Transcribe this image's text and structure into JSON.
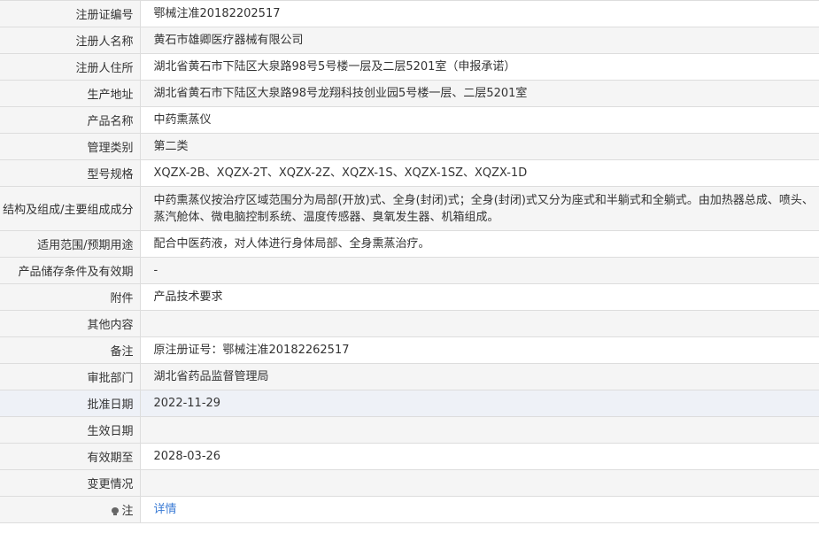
{
  "rows": [
    {
      "label": "注册证编号",
      "value": "鄂械注准20182202517"
    },
    {
      "label": "注册人名称",
      "value": "黄石市雄卿医疗器械有限公司"
    },
    {
      "label": "注册人住所",
      "value": "湖北省黄石市下陆区大泉路98号5号楼一层及二层5201室（申报承诺）"
    },
    {
      "label": "生产地址",
      "value": "湖北省黄石市下陆区大泉路98号龙翔科技创业园5号楼一层、二层5201室"
    },
    {
      "label": "产品名称",
      "value": "中药熏蒸仪"
    },
    {
      "label": "管理类别",
      "value": "第二类"
    },
    {
      "label": "型号规格",
      "value": "XQZX-2B、XQZX-2T、XQZX-2Z、XQZX-1S、XQZX-1SZ、XQZX-1D"
    },
    {
      "label": "结构及组成/主要组成成分",
      "value": "中药熏蒸仪按治疗区域范围分为局部(开放)式、全身(封闭)式；全身(封闭)式又分为座式和半躺式和全躺式。由加热器总成、喷头、蒸汽舱体、微电脑控制系统、温度传感器、臭氧发生器、机箱组成。"
    },
    {
      "label": "适用范围/预期用途",
      "value": "配合中医药液，对人体进行身体局部、全身熏蒸治疗。"
    },
    {
      "label": "产品储存条件及有效期",
      "value": "-"
    },
    {
      "label": "附件",
      "value": "产品技术要求"
    },
    {
      "label": "其他内容",
      "value": ""
    },
    {
      "label": "备注",
      "value": "原注册证号：鄂械注准20182262517"
    },
    {
      "label": "审批部门",
      "value": "湖北省药品监督管理局"
    },
    {
      "label": "批准日期",
      "value": "2022-11-29"
    },
    {
      "label": "生效日期",
      "value": ""
    },
    {
      "label": "有效期至",
      "value": "2028-03-26"
    },
    {
      "label": "变更情况",
      "value": ""
    },
    {
      "label": "注",
      "value": "详情",
      "icon": "lightbulb-icon"
    }
  ]
}
